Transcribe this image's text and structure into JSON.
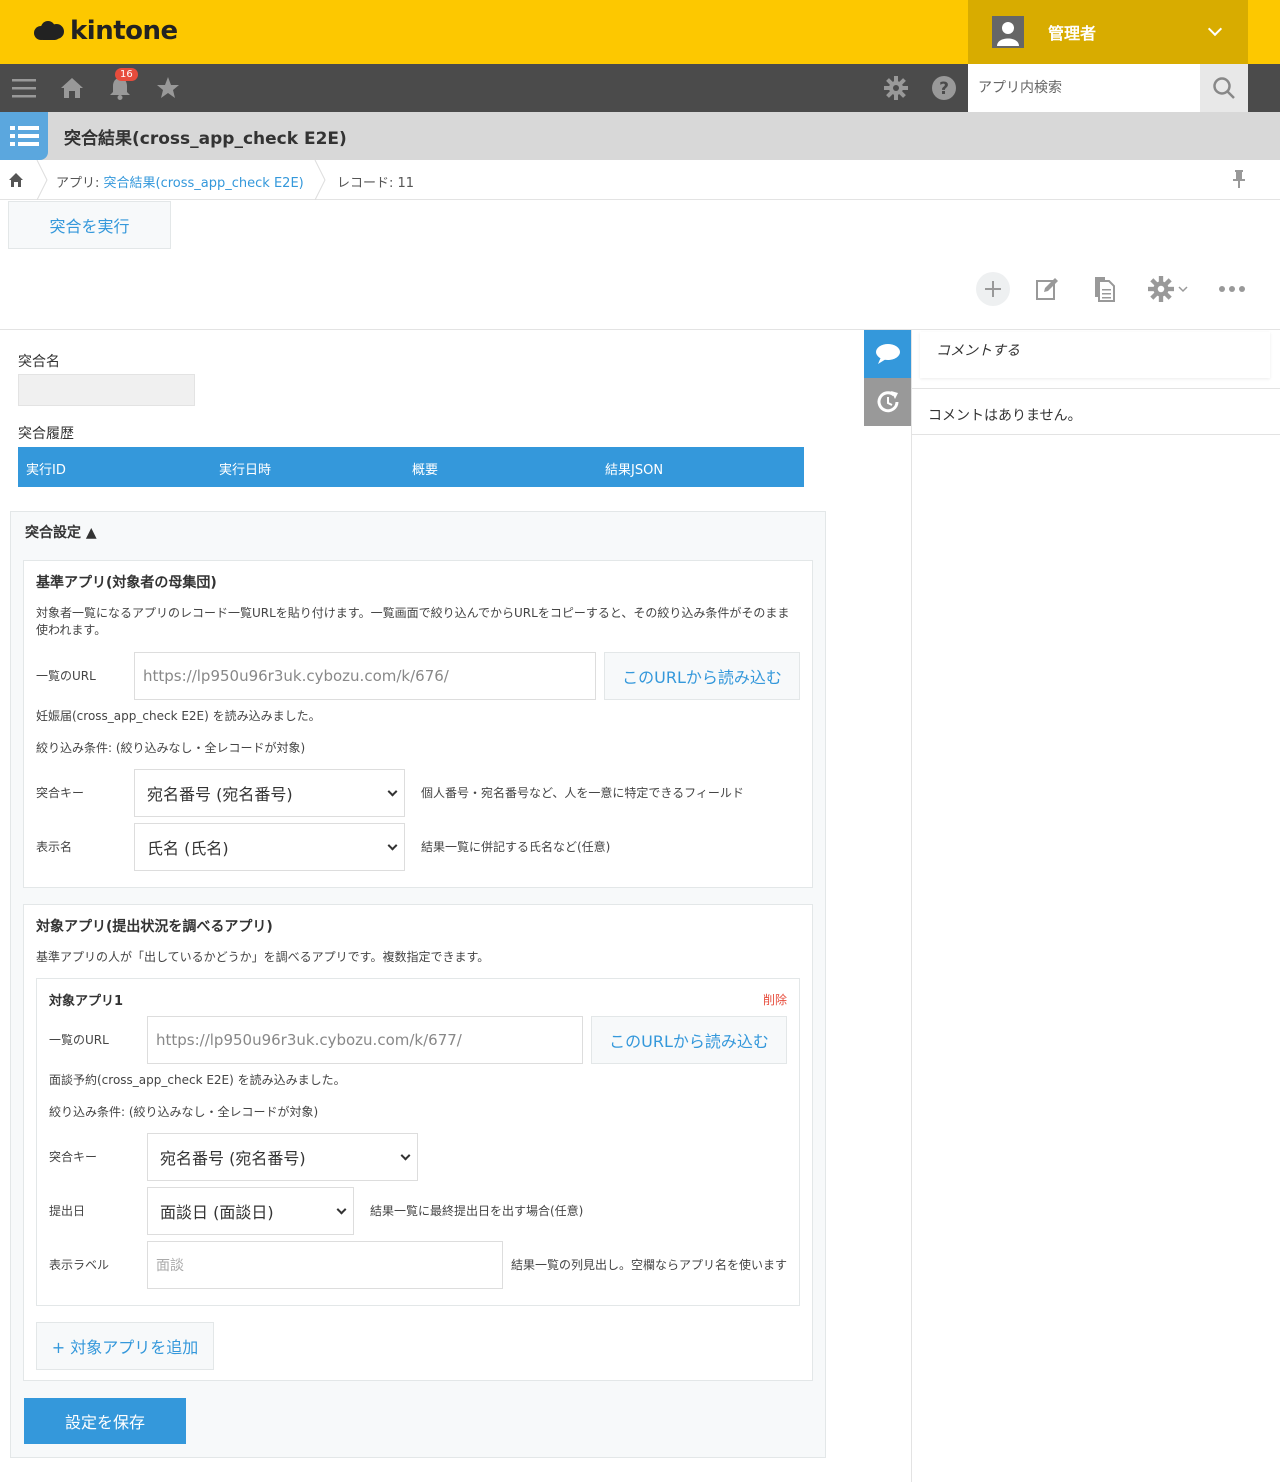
{
  "header": {
    "logo": "kintone",
    "user_name": "管理者"
  },
  "toolbar": {
    "notification_count": "16",
    "search_placeholder": "アプリ内検索"
  },
  "app": {
    "title": "突合結果(cross_app_check E2E)"
  },
  "breadcrumb": {
    "app_prefix": "アプリ: ",
    "app_link": "突合結果(cross_app_check E2E)",
    "record": "レコード: 11"
  },
  "actions": {
    "run_label": "突合を実行"
  },
  "record": {
    "name_label": "突合名",
    "history_label": "突合履歴",
    "history_columns": [
      "実行ID",
      "実行日時",
      "概要",
      "結果JSON"
    ]
  },
  "settings": {
    "title": "突合設定 ▲",
    "base": {
      "title": "基準アプリ(対象者の母集団)",
      "description_line1": "対象者一覧になるアプリのレコード一覧URLを貼り付けます。一覧画面で絞り込んでからURLをコピーすると、その絞り込み条件がそのまま",
      "description_line2": "使われます。",
      "url_label": "一覧のURL",
      "url_value": "https://lp950u96r3uk.cybozu.com/k/676/",
      "load_button": "このURLから読み込む",
      "loaded_message": "妊娠届(cross_app_check E2E) を読み込みました。",
      "filter_message": "絞り込み条件: (絞り込みなし・全レコードが対象)",
      "key_label": "突合キー",
      "key_value": "宛名番号 (宛名番号)",
      "key_hint": "個人番号・宛名番号など、人を一意に特定できるフィールド",
      "display_label": "表示名",
      "display_value": "氏名 (氏名)",
      "display_hint": "結果一覧に併記する氏名など(任意)"
    },
    "target": {
      "title": "対象アプリ(提出状況を調べるアプリ)",
      "description": "基準アプリの人が「出しているかどうか」を調べるアプリです。複数指定できます。",
      "apps": [
        {
          "title": "対象アプリ1",
          "delete_label": "削除",
          "url_label": "一覧のURL",
          "url_value": "https://lp950u96r3uk.cybozu.com/k/677/",
          "load_button": "このURLから読み込む",
          "loaded_message": "面談予約(cross_app_check E2E) を読み込みました。",
          "filter_message": "絞り込み条件: (絞り込みなし・全レコードが対象)",
          "key_label": "突合キー",
          "key_value": "宛名番号 (宛名番号)",
          "date_label": "提出日",
          "date_value": "面談日 (面談日)",
          "date_hint": "結果一覧に最終提出日を出す場合(任意)",
          "label_label": "表示ラベル",
          "label_placeholder": "面談",
          "label_hint": "結果一覧の列見出し。空欄ならアプリ名を使います"
        }
      ],
      "add_button": "+ 対象アプリを追加"
    },
    "save_button": "設定を保存"
  },
  "comments": {
    "input_placeholder": "コメントする",
    "empty_message": "コメントはありません。"
  },
  "colors": {
    "header": "#fdc800",
    "toolbar": "#4b4b4b",
    "accent": "#3498db",
    "delete": "#e74c3c"
  }
}
